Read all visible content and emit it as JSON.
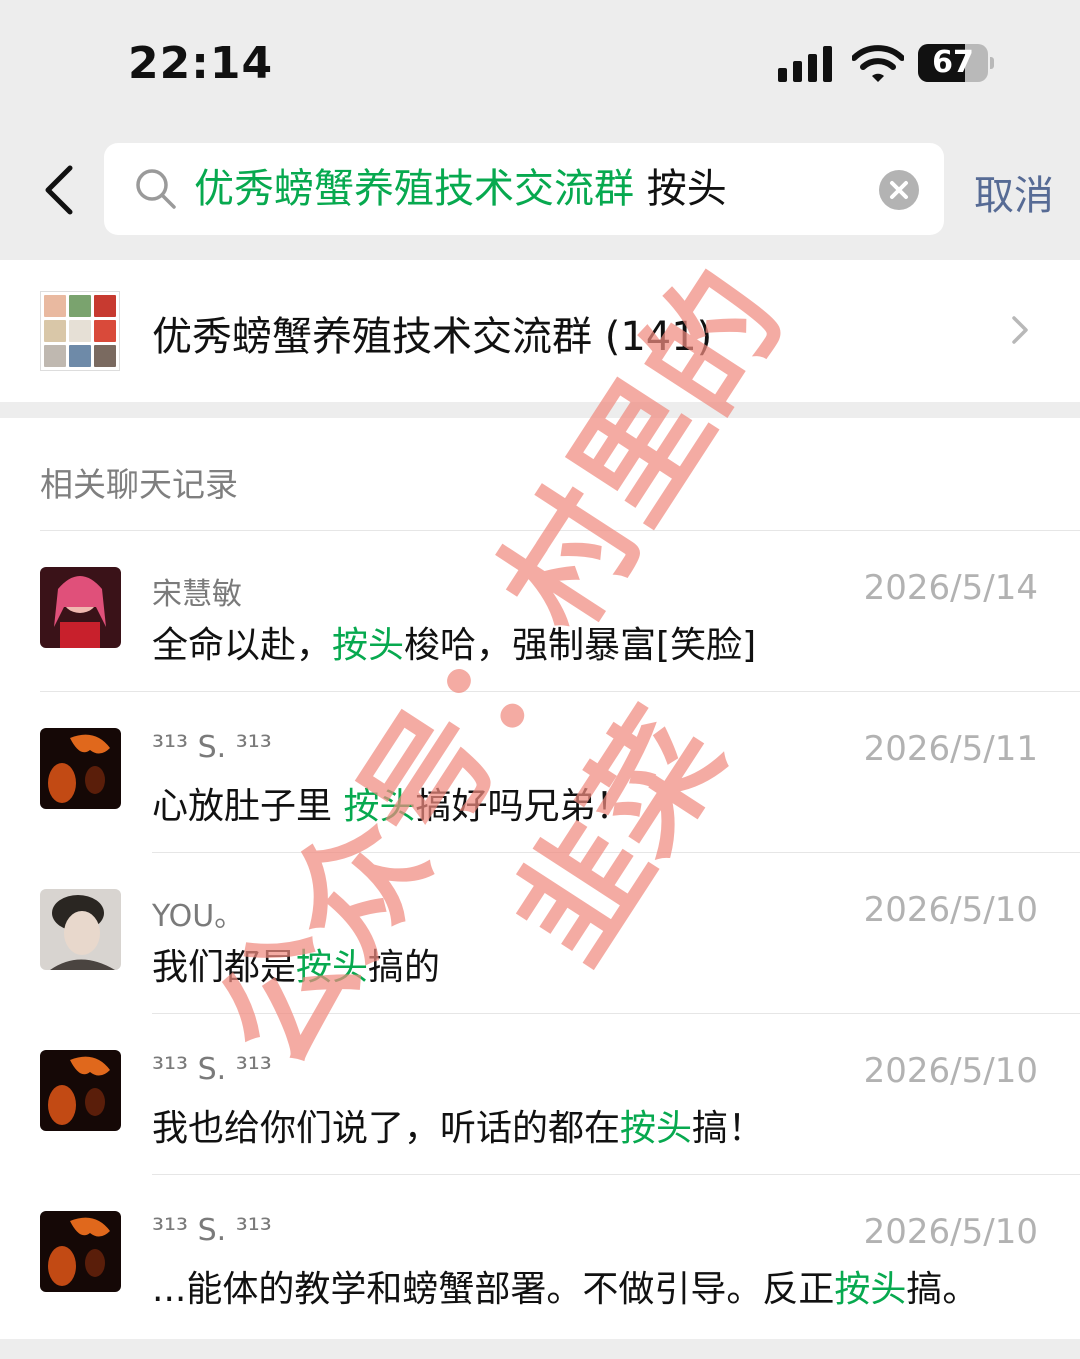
{
  "status_bar": {
    "time": "22:14",
    "battery_percent": "67",
    "battery_level": 0.67
  },
  "search": {
    "query_highlight": "优秀螃蟹养殖技术交流群",
    "query_rest": " 按头",
    "cancel_label": "取消"
  },
  "group_result": {
    "name": "优秀螃蟹养殖技术交流群 (141)"
  },
  "records": {
    "title": "相关聊天记录",
    "items": [
      {
        "sender": "宋慧敏",
        "date": "2026/5/14",
        "pre": "全命以赴，",
        "hl": "按头",
        "post": "梭哈，强制暴富[笑脸]"
      },
      {
        "sender": "³¹³ S. ³¹³",
        "date": "2026/5/11",
        "pre": "心放肚子里 ",
        "hl": "按头",
        "post": "搞好吗兄弟！"
      },
      {
        "sender": "YOU。",
        "date": "2026/5/10",
        "pre": "我们都是",
        "hl": "按头",
        "post": "搞的"
      },
      {
        "sender": "³¹³ S. ³¹³",
        "date": "2026/5/10",
        "pre": "我也给你们说了，听话的都在",
        "hl": "按头",
        "post": "搞！"
      },
      {
        "sender": "³¹³ S. ³¹³",
        "date": "2026/5/10",
        "pre": "...能体的教学和螃蟹部署。不做引导。反正",
        "hl": "按头",
        "post": "搞。"
      }
    ]
  },
  "watermark": {
    "line1": "公众号：村里的",
    "line2": "韭菜"
  },
  "colors": {
    "highlight": "#07a94f",
    "link": "#576b95",
    "watermark": "#f08a80"
  }
}
